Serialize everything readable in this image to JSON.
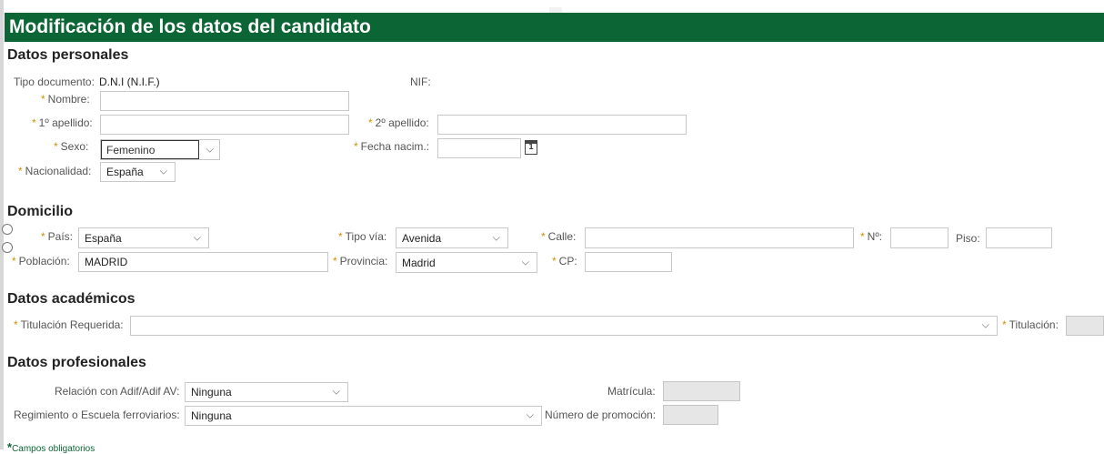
{
  "title": "Modificación de los datos del candidato",
  "sections": {
    "personal": "Datos personales",
    "domicilio": "Domicilio",
    "academicos": "Datos académicos",
    "profesionales": "Datos profesionales"
  },
  "personal": {
    "tipo_documento_label": "Tipo documento:",
    "tipo_documento_value": "D.N.I (N.I.F.)",
    "nif_label": "NIF:",
    "nombre_label": "Nombre:",
    "apellido1_label": "1º apellido:",
    "apellido2_label": "2º apellido:",
    "sexo_label": "Sexo:",
    "sexo_value": "Femenino",
    "fecha_label": "Fecha nacim.:",
    "calendar_day": "1",
    "nacionalidad_label": "Nacionalidad:",
    "nacionalidad_value": "España"
  },
  "domicilio": {
    "pais_label": "País:",
    "pais_value": "España",
    "tipo_via_label": "Tipo vía:",
    "tipo_via_value": "Avenida",
    "calle_label": "Calle:",
    "numero_label": "Nº:",
    "piso_label": "Piso:",
    "poblacion_label": "Población:",
    "poblacion_value": "MADRID",
    "provincia_label": "Provincia:",
    "provincia_value": "Madrid",
    "cp_label": "CP:"
  },
  "academicos": {
    "titulacion_requerida_label": "Titulación Requerida:",
    "titulacion_label": "Titulación:"
  },
  "profesionales": {
    "relacion_label": "Relación con Adif/Adif AV:",
    "relacion_value": "Ninguna",
    "matricula_label": "Matrícula:",
    "regimiento_label": "Regimiento o Escuela ferroviarios:",
    "regimiento_value": "Ninguna",
    "promocion_label": "Número de promoción:"
  },
  "footer": {
    "required_marker": "*",
    "required_note": "Campos obligatorios"
  },
  "icons": {
    "required_marker": "*",
    "dropdown": "chevron-down-icon",
    "calendar": "calendar-icon"
  },
  "colors": {
    "header_bg": "#0c6534",
    "required_star": "#d09000"
  }
}
